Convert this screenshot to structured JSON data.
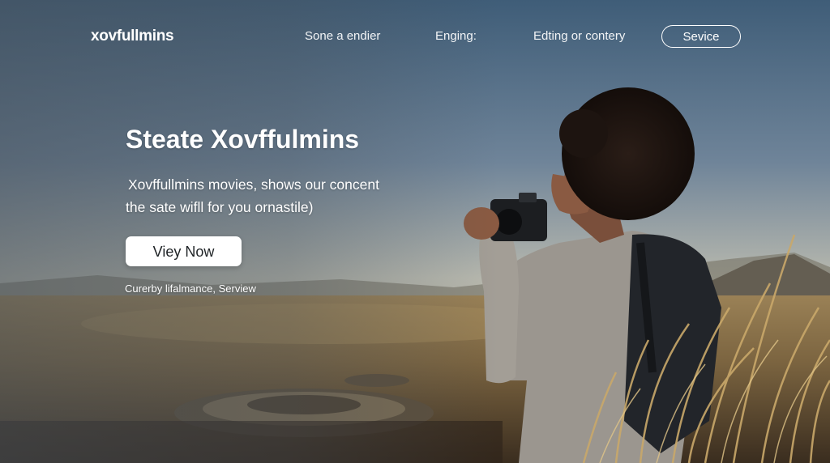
{
  "nav": {
    "logo": "xovfullmins",
    "links": [
      "Sone a endier",
      "Enging:",
      "Edting or contery"
    ],
    "cta": "Sevice"
  },
  "hero": {
    "headline": "Steate Xovffulmins",
    "subline_1": "Xovffullmins movies, shows our concent",
    "subline_2": "the sate wifll for  you ornastile)",
    "button": "Viey Now",
    "caption": "Curerby lifalmance, Serview"
  },
  "colors": {
    "text": "#ffffff",
    "button_bg": "#ffffff",
    "button_text": "#1f2326"
  }
}
